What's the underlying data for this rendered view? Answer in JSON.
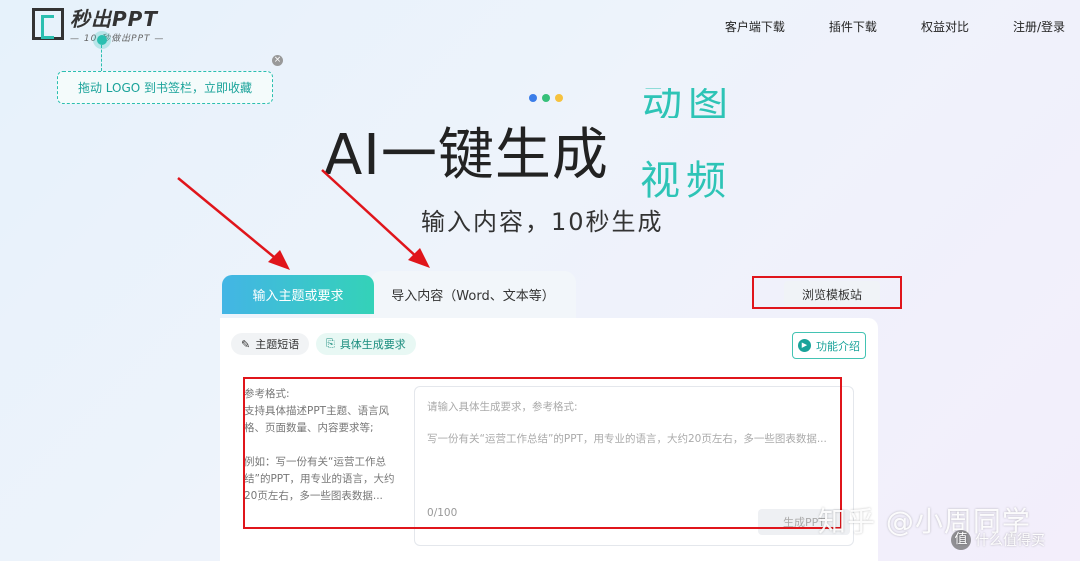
{
  "header": {
    "logo_title": "秒出PPT",
    "logo_sub": "— 10 秒做出PPT —",
    "drag_tip": "拖动 LOGO 到书签栏，立即收藏",
    "close_glyph": "×",
    "nav": [
      "客户端下载",
      "插件下载",
      "权益对比",
      "注册/登录"
    ]
  },
  "hero": {
    "title": "AI一键生成",
    "roll_prev": "动图",
    "roll_current": "视频",
    "subtitle": "输入内容，10秒生成",
    "dot_colors": [
      "#3b7de9",
      "#36c07a",
      "#f6c23e"
    ]
  },
  "tabs": {
    "active": "输入主题或要求",
    "inactive": "导入内容（Word、文本等）"
  },
  "browse_button": "浏览模板站",
  "chips": {
    "topic": "主题短语",
    "topic_icon": "✎",
    "requirement": "具体生成要求",
    "requirement_icon": "⎘"
  },
  "intro_button": "功能介绍",
  "reference": {
    "heading": "参考格式:",
    "line1": "支持具体描述PPT主题、语言风格、页面数量、内容要求等;",
    "line2": "例如：写一份有关“运营工作总结”的PPT，用专业的语言，大约20页左右，多一些图表数据..."
  },
  "input": {
    "placeholder1": "请输入具体生成要求，参考格式:",
    "placeholder2": "写一份有关“运营工作总结”的PPT，用专业的语言，大约20页左右，多一些图表数据...",
    "count": "0",
    "max": "/100"
  },
  "generate_button": "生成PPT",
  "watermark": {
    "main": "知乎 @小周同学",
    "sub": "什么值得买",
    "badge": "值"
  },
  "colors": {
    "accent": "#2ec4b6",
    "highlight": "#e0151b"
  }
}
